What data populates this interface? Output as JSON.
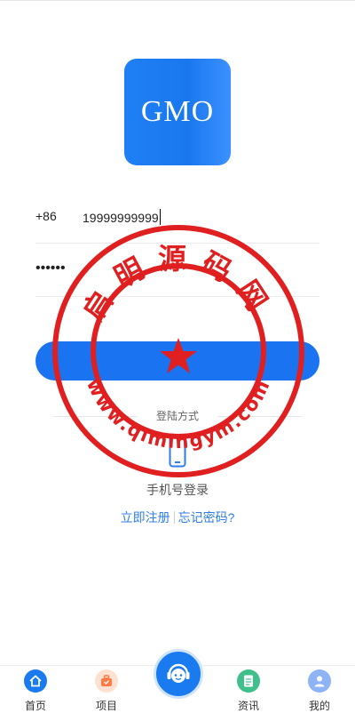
{
  "app": {
    "logo_text": "GMO"
  },
  "form": {
    "phone_prefix": "+86",
    "phone_value": "19999999999",
    "password_mask": "••••••",
    "login_label": ""
  },
  "login_methods": {
    "heading": "登陆方式",
    "phone_login_label": "手机号登录"
  },
  "links": {
    "register": "立即注册",
    "forgot": "忘记密码?"
  },
  "watermark": {
    "top_text": "启明源码网",
    "bottom_text": "www.qimingym.com",
    "color": "#e02020"
  },
  "tabbar": {
    "items": [
      {
        "label": "首页",
        "icon": "home-icon",
        "color": "#1a7bf0"
      },
      {
        "label": "项目",
        "icon": "briefcase-icon",
        "color": "#ff8a5b"
      },
      {
        "label": "资讯",
        "icon": "document-icon",
        "color": "#3fbf8a"
      },
      {
        "label": "我的",
        "icon": "user-icon",
        "color": "#8fb4f5"
      }
    ],
    "center_icon": "customer-service-icon"
  },
  "colors": {
    "accent": "#1a73f0",
    "link": "#2f7ee8"
  }
}
